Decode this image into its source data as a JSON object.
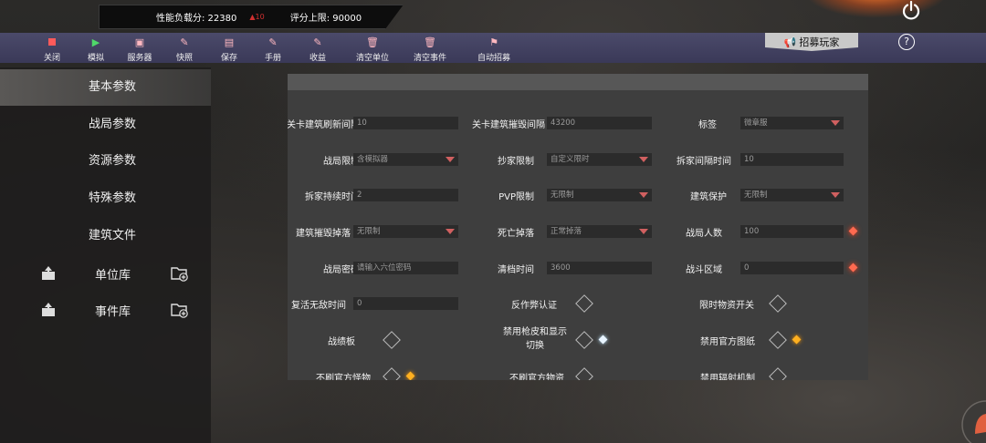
{
  "header": {
    "perf_label": "性能负载分: 22380",
    "warn_value": "▲10",
    "score_cap_label": "评分上限: 90000"
  },
  "toolbar": {
    "items": [
      {
        "label": "关闭",
        "icon": "stop-icon"
      },
      {
        "label": "模拟",
        "icon": "play-icon"
      },
      {
        "label": "服务器",
        "icon": "box-icon"
      },
      {
        "label": "快照",
        "icon": "edit-icon"
      },
      {
        "label": "保存",
        "icon": "file-icon"
      },
      {
        "label": "手册",
        "icon": "edit-icon"
      },
      {
        "label": "收益",
        "icon": "edit-icon"
      },
      {
        "label": "清空单位",
        "icon": "trash-icon"
      },
      {
        "label": "清空事件",
        "icon": "trash-icon"
      },
      {
        "label": "自动招募",
        "icon": "flag-icon"
      }
    ],
    "recruit_label": "招募玩家",
    "help_label": "?"
  },
  "sidebar": {
    "items": [
      {
        "label": "基本参数",
        "active": true
      },
      {
        "label": "战局参数",
        "active": false
      },
      {
        "label": "资源参数",
        "active": false
      },
      {
        "label": "特殊参数",
        "active": false
      },
      {
        "label": "建筑文件",
        "active": false
      }
    ],
    "libraries": [
      {
        "label": "单位库"
      },
      {
        "label": "事件库"
      }
    ]
  },
  "form": {
    "rows": [
      [
        {
          "label": "关卡建筑刷新间隔",
          "type": "input",
          "value": "10"
        },
        {
          "label": "关卡建筑摧毁间隔",
          "type": "input",
          "value": "43200"
        },
        {
          "label": "标签",
          "type": "select",
          "value": "微章服"
        }
      ],
      [
        {
          "label": "战局限制",
          "type": "select",
          "value": "含模拟器"
        },
        {
          "label": "抄家限制",
          "type": "select",
          "value": "自定义限时"
        },
        {
          "label": "拆家间隔时间",
          "type": "input",
          "value": "10"
        }
      ],
      [
        {
          "label": "拆家持续时间",
          "type": "input",
          "value": "2"
        },
        {
          "label": "PVP限制",
          "type": "select",
          "value": "无限制"
        },
        {
          "label": "建筑保护",
          "type": "select",
          "value": "无限制"
        }
      ],
      [
        {
          "label": "建筑摧毁掉落",
          "type": "select",
          "value": "无限制"
        },
        {
          "label": "死亡掉落",
          "type": "select",
          "value": "正常掉落"
        },
        {
          "label": "战局人数",
          "type": "input",
          "value": "100"
        }
      ],
      [
        {
          "label": "战局密码",
          "type": "input",
          "value": "请输入六位密码"
        },
        {
          "label": "清档时间",
          "type": "input",
          "value": "3600"
        },
        {
          "label": "战斗区域",
          "type": "input",
          "value": "0"
        }
      ],
      [
        {
          "label": "复活无敌时间",
          "type": "input",
          "value": "0"
        },
        {
          "label": "反作弊认证",
          "type": "check"
        },
        {
          "label": "限时物资开关",
          "type": "check"
        }
      ],
      [
        {
          "label": "战绩板",
          "type": "check"
        },
        {
          "label": "禁用枪皮和显示",
          "label2": "切换",
          "type": "check"
        },
        {
          "label": "禁用官方图纸",
          "type": "check"
        }
      ],
      [
        {
          "label": "不刷官方怪物",
          "type": "check"
        },
        {
          "label": "不刷官方物资",
          "type": "check"
        },
        {
          "label": "禁用辐射机制",
          "type": "check"
        }
      ]
    ]
  }
}
